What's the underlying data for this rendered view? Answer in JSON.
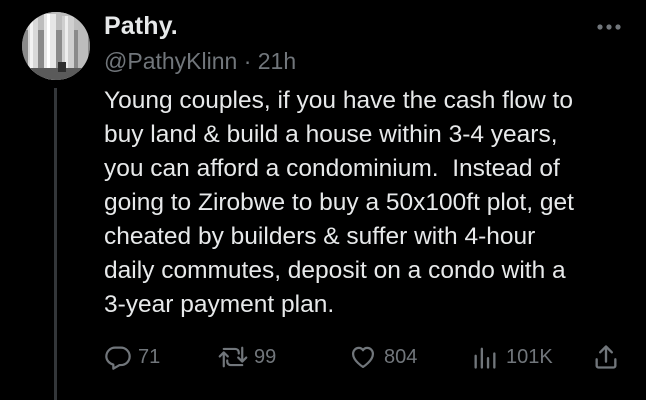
{
  "tweet": {
    "display_name": "Pathy.",
    "handle": "@PathyKlinn",
    "separator": "·",
    "time": "21h",
    "text_lines": [
      "Young couples, if you have the cash flow to",
      "buy land & build a house within 3-4 years,",
      "you can afford a condominium.  Instead of",
      "going to Zirobwe to buy a 50x100ft plot, get",
      "cheated by builders & suffer with 4-hour",
      "daily commutes, deposit on a condo with a",
      "3-year payment plan."
    ],
    "avatar_icon": "profile-photo-pillars",
    "more_icon": "more-dots-icon"
  },
  "actions": {
    "replies": {
      "icon": "reply-icon",
      "count": "71"
    },
    "retweets": {
      "icon": "retweet-icon",
      "count": "99"
    },
    "likes": {
      "icon": "like-heart-icon",
      "count": "804"
    },
    "views": {
      "icon": "views-chart-icon",
      "count": "101K"
    },
    "share": {
      "icon": "share-icon"
    }
  },
  "colors": {
    "background": "#000000",
    "text_primary": "#e7e9ea",
    "text_secondary": "#71767b",
    "divider": "#333639"
  }
}
